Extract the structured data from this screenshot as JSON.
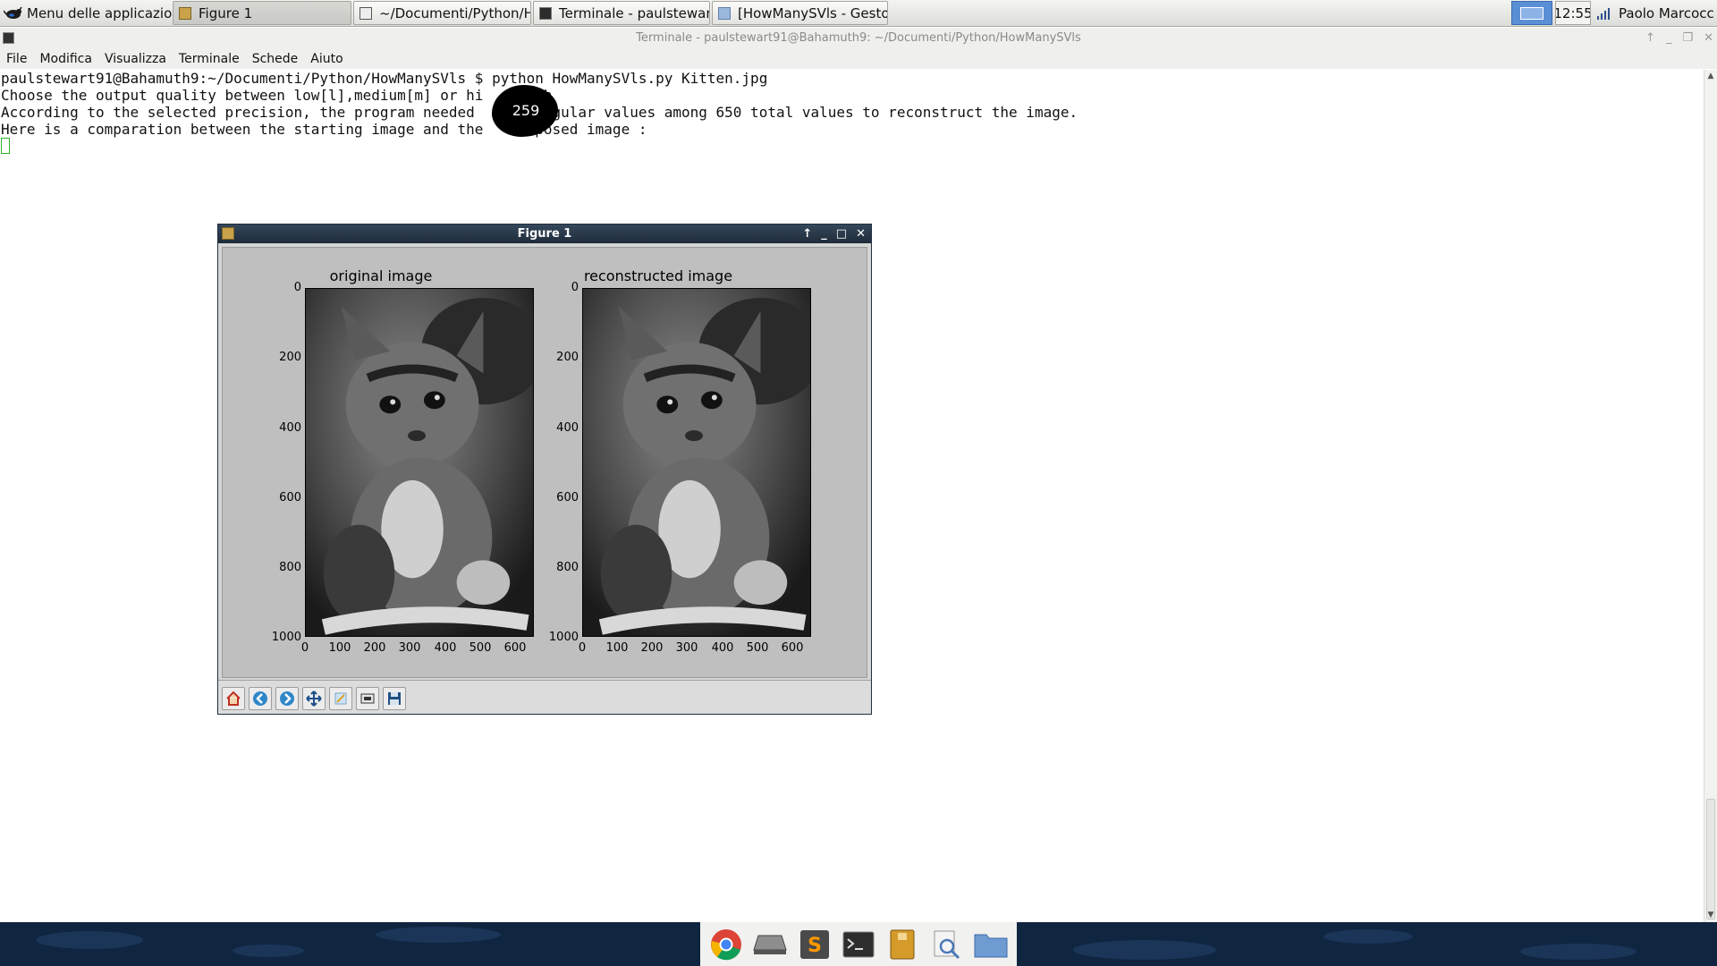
{
  "top_panel": {
    "app_menu_label": "Menu delle applicazioni",
    "tasks": [
      {
        "label": "Figure 1",
        "icon": "figure-icon"
      },
      {
        "label": "~/Documenti/Python/Ho...",
        "icon": "text-editor-icon"
      },
      {
        "label": "Terminale - paulstewart...",
        "icon": "terminal-icon"
      },
      {
        "label": "[HowManySVls - Gestor...",
        "icon": "folder-icon"
      }
    ],
    "clock": "12:55",
    "user": "Paolo Marcoccia"
  },
  "terminal": {
    "title": "Terminale - paulstewart91@Bahamuth9: ~/Documenti/Python/HowManySVls",
    "menu": [
      "File",
      "Modifica",
      "Visualizza",
      "Terminale",
      "Schede",
      "Aiuto"
    ],
    "lines": [
      "paulstewart91@Bahamuth9:~/Documenti/Python/HowManySVls $ python HowManySVls.py Kitten.jpg",
      "Choose the output quality between low[l],medium[m] or hi      :h",
      "According to the selected precision, the program needed      singular values among 650 total values to reconstruct the image.",
      "Here is a comparation between the starting image and the      posed image :"
    ],
    "annotation_value": "259"
  },
  "figure": {
    "window_title": "Figure 1",
    "subplots": [
      {
        "title": "original image"
      },
      {
        "title": "reconstructed image"
      }
    ],
    "y_ticks": [
      "0",
      "200",
      "400",
      "600",
      "800",
      "1000"
    ],
    "x_ticks": [
      "0",
      "100",
      "200",
      "300",
      "400",
      "500",
      "600"
    ],
    "toolbar": [
      "home-icon",
      "back-icon",
      "forward-icon",
      "pan-icon",
      "zoom-icon",
      "configure-subplots-icon",
      "save-icon"
    ]
  },
  "dock": {
    "apps": [
      "chrome-icon",
      "drive-icon",
      "sublime-text-icon",
      "terminal-icon",
      "archive-icon",
      "search-icon",
      "files-icon"
    ]
  },
  "colors": {
    "terminal_background": "#ffffff",
    "dock_background": "#0f2540",
    "figure_titlebar": "#2a3a4c",
    "cursor": "#2ab32a"
  }
}
